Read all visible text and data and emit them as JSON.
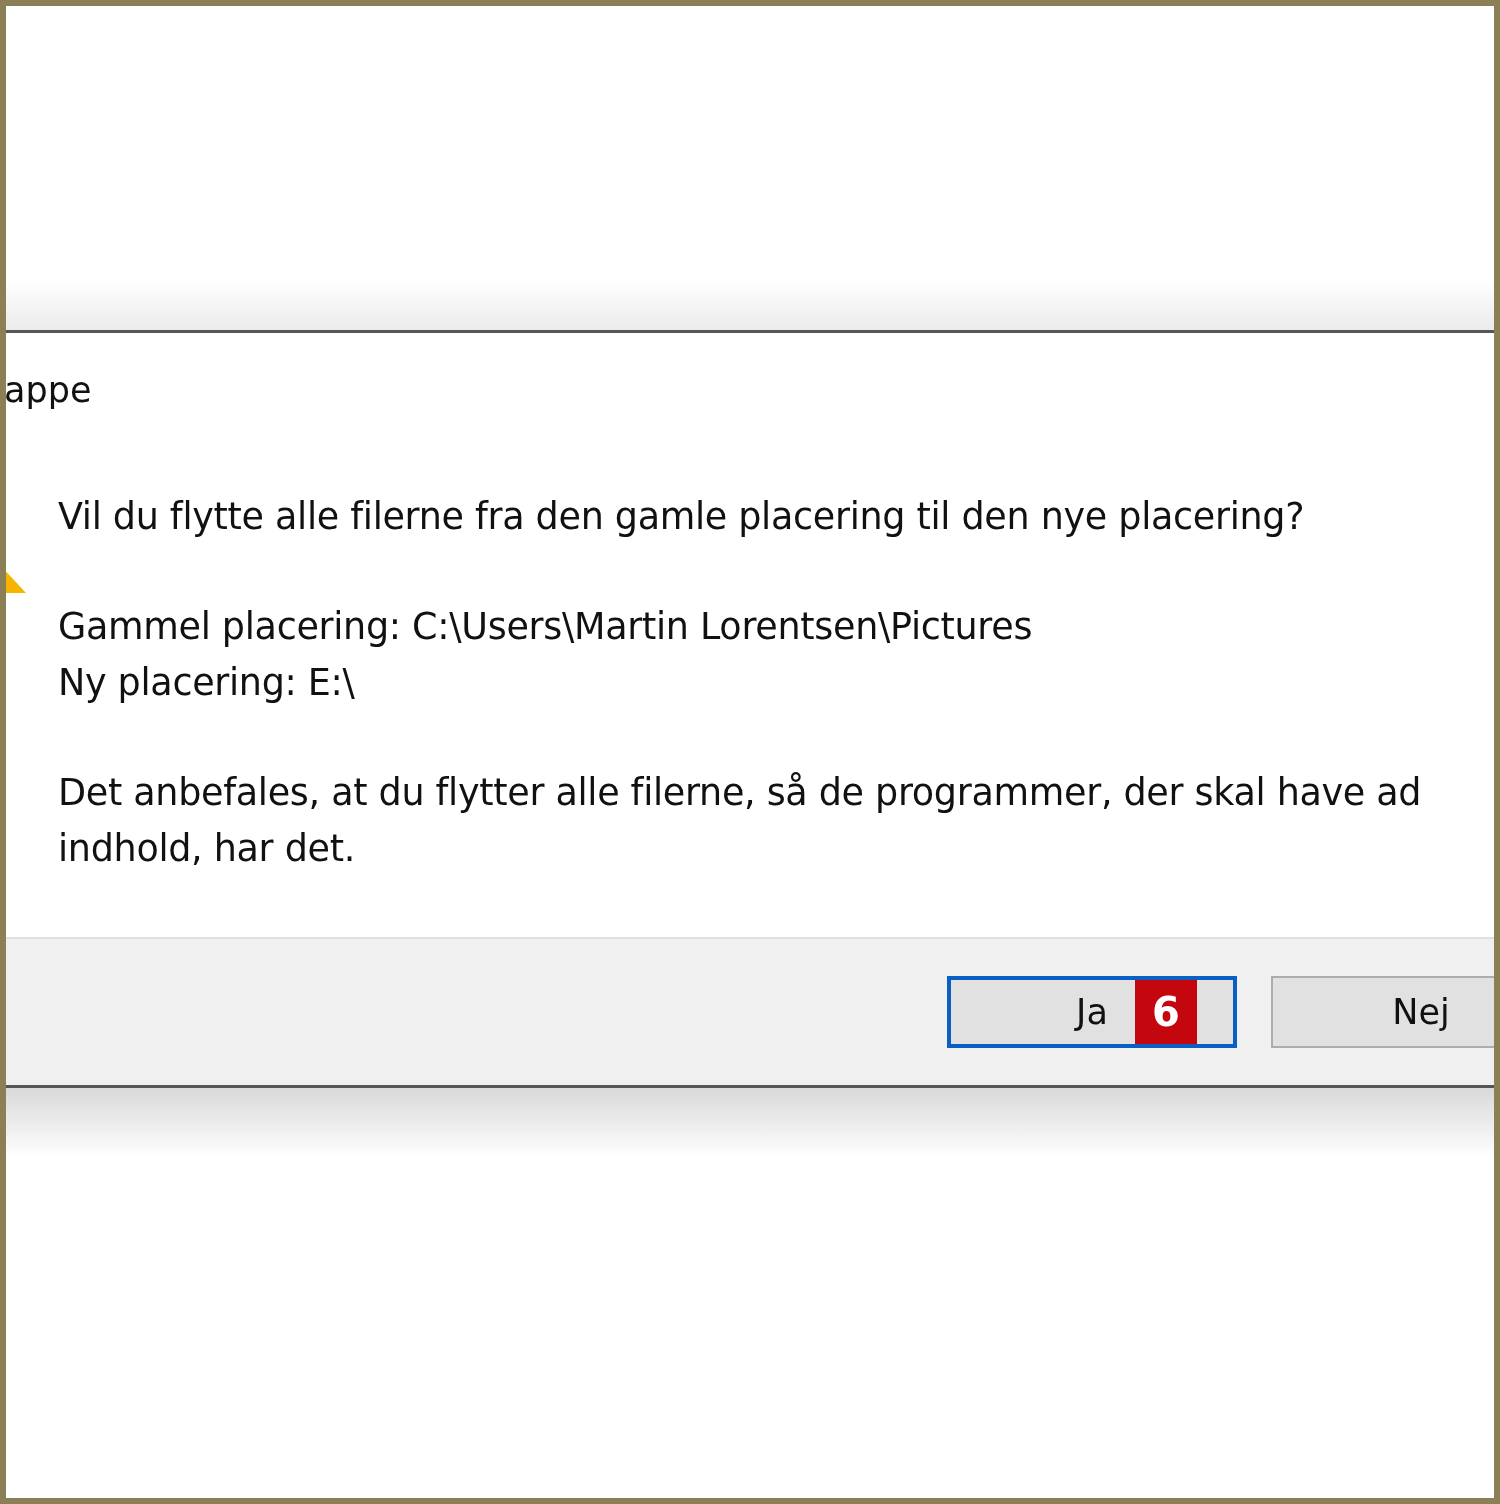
{
  "dialog": {
    "title": "appe",
    "message": "Vil du flytte alle filerne fra den gamle placering til den nye placering?",
    "details": [
      "Gammel placering: C:\\Users\\Martin Lorentsen\\Pictures",
      "Ny placering: E:\\"
    ],
    "note_lines": [
      "Det anbefales, at du flytter alle filerne, så de programmer, der skal have ad",
      "indhold, har det."
    ],
    "buttons": [
      {
        "label": "Ja",
        "default": true,
        "badge": "6"
      },
      {
        "label": "Nej",
        "default": false
      }
    ]
  }
}
